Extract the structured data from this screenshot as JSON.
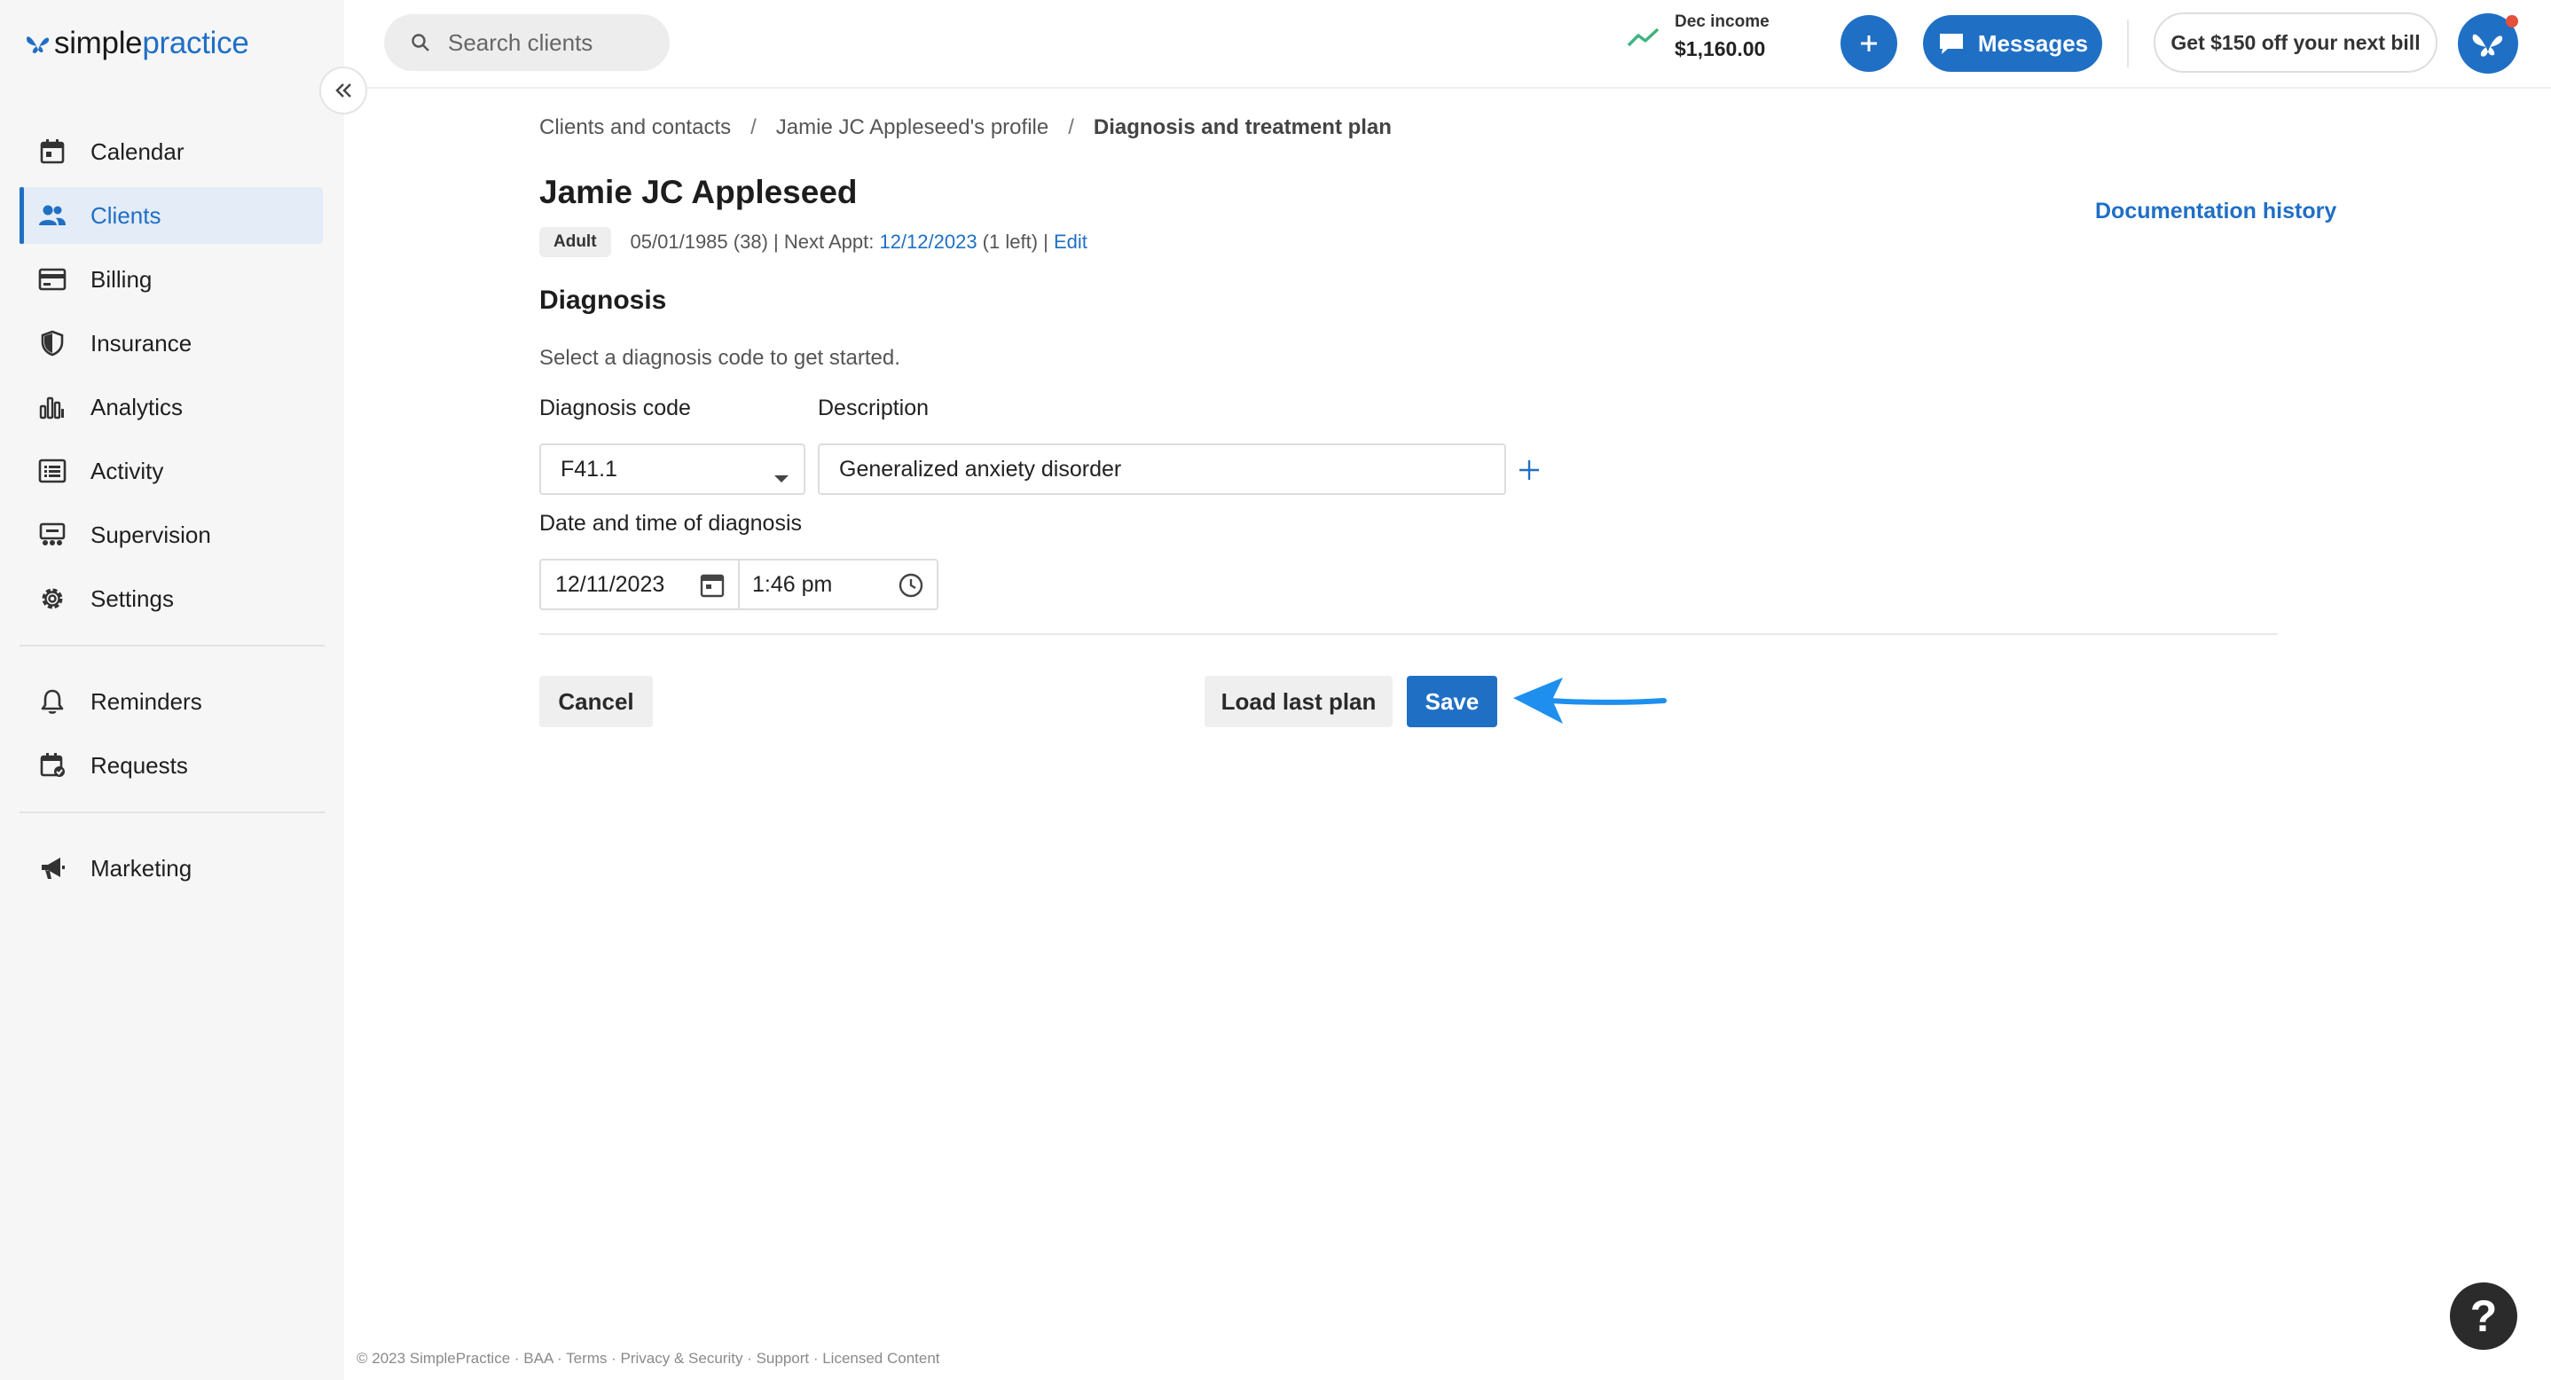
{
  "brand": {
    "name_part1": "simple",
    "name_part2": "practice",
    "color": "#1f6fc5"
  },
  "sidebar": {
    "collapse_icon": "double-chevron-left-icon",
    "items": [
      {
        "label": "Calendar",
        "icon": "calendar-icon",
        "active": false
      },
      {
        "label": "Clients",
        "icon": "users-icon",
        "active": true
      },
      {
        "label": "Billing",
        "icon": "credit-card-icon",
        "active": false
      },
      {
        "label": "Insurance",
        "icon": "shield-icon",
        "active": false
      },
      {
        "label": "Analytics",
        "icon": "bar-chart-icon",
        "active": false
      },
      {
        "label": "Activity",
        "icon": "list-icon",
        "active": false
      },
      {
        "label": "Supervision",
        "icon": "supervision-icon",
        "active": false
      },
      {
        "label": "Settings",
        "icon": "gear-icon",
        "active": false
      },
      {
        "label": "Reminders",
        "icon": "bell-icon",
        "active": false
      },
      {
        "label": "Requests",
        "icon": "calendar-request-icon",
        "active": false
      },
      {
        "label": "Marketing",
        "icon": "megaphone-icon",
        "active": false
      }
    ]
  },
  "topbar": {
    "search_placeholder": "Search clients",
    "income_label": "Dec income",
    "income_value": "$1,160.00",
    "messages_label": "Messages",
    "promo_label": "Get $150 off your next bill"
  },
  "breadcrumb": {
    "item1": "Clients and contacts",
    "item2": "Jamie JC Appleseed's profile",
    "current": "Diagnosis and treatment plan",
    "separator": "/"
  },
  "client": {
    "name": "Jamie JC Appleseed",
    "badge": "Adult",
    "dob": "05/01/1985 (38)",
    "next_appt_label": " | Next Appt: ",
    "next_appt_date": "12/12/2023",
    "remaining": " (1 left) | ",
    "edit_label": "Edit"
  },
  "documentation_history_label": "Documentation history",
  "diagnosis": {
    "title": "Diagnosis",
    "helper": "Select a diagnosis code to get started.",
    "code_label": "Diagnosis code",
    "code_value": "F41.1",
    "description_label": "Description",
    "description_value": "Generalized anxiety disorder",
    "datetime_label": "Date and time of diagnosis",
    "date_value": "12/11/2023",
    "time_value": "1:46 pm"
  },
  "actions": {
    "cancel": "Cancel",
    "load_last_plan": "Load last plan",
    "save": "Save"
  },
  "footer": "© 2023 SimplePractice · BAA · Terms · Privacy & Security · Support · Licensed Content",
  "help_label": "?"
}
